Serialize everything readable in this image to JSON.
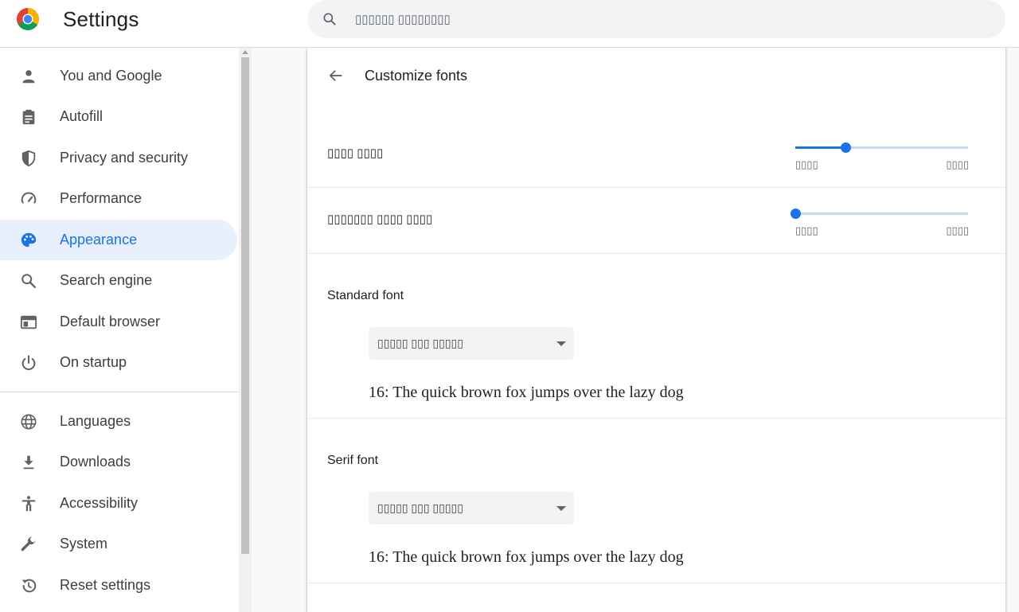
{
  "header": {
    "title": "Settings",
    "logo_icon": "chrome-logo",
    "search": {
      "placeholder": "▯▯▯▯▯▯ ▯▯▯▯▯▯▯▯",
      "icon": "search-icon"
    }
  },
  "sidebar": {
    "items": [
      {
        "label": "You and Google",
        "icon": "person-icon"
      },
      {
        "label": "Autofill",
        "icon": "clipboard-icon"
      },
      {
        "label": "Privacy and security",
        "icon": "shield-icon"
      },
      {
        "label": "Performance",
        "icon": "speedometer-icon"
      },
      {
        "label": "Appearance",
        "icon": "palette-icon",
        "active": true
      },
      {
        "label": "Search engine",
        "icon": "search-icon"
      },
      {
        "label": "Default browser",
        "icon": "browser-icon"
      },
      {
        "label": "On startup",
        "icon": "power-icon"
      },
      {
        "label": "Languages",
        "icon": "globe-icon"
      },
      {
        "label": "Downloads",
        "icon": "download-icon"
      },
      {
        "label": "Accessibility",
        "icon": "accessibility-icon"
      },
      {
        "label": "System",
        "icon": "wrench-icon"
      },
      {
        "label": "Reset settings",
        "icon": "reset-icon"
      }
    ]
  },
  "main": {
    "title": "Customize fonts",
    "font_size": {
      "label": "▯▯▯▯ ▯▯▯▯",
      "min_label": "▯▯▯▯",
      "max_label": "▯▯▯▯",
      "value_fraction": 0.29
    },
    "min_font_size": {
      "label": "▯▯▯▯▯▯▯ ▯▯▯▯ ▯▯▯▯",
      "min_label": "▯▯▯▯",
      "max_label": "▯▯▯▯",
      "value_fraction": 0.0
    },
    "standard_font": {
      "title": "Standard font",
      "selected": "▯▯▯▯▯ ▯▯▯ ▯▯▯▯▯",
      "sample": "16: The quick brown fox jumps over the lazy dog"
    },
    "serif_font": {
      "title": "Serif font",
      "selected": "▯▯▯▯▯ ▯▯▯ ▯▯▯▯▯",
      "sample": "16: The quick brown fox jumps over the lazy dog"
    }
  },
  "colors": {
    "accent": "#1a73e8",
    "active_bg": "#e8f0fe",
    "text_primary": "#202124",
    "text_secondary": "#5f6368"
  }
}
